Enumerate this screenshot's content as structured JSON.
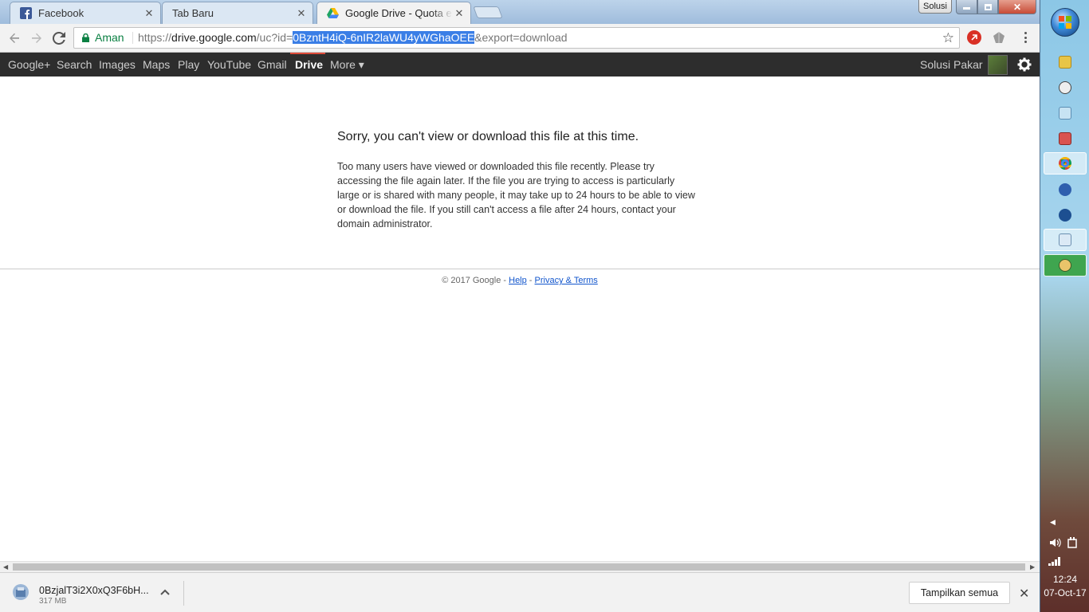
{
  "tabs": [
    {
      "title": "Facebook",
      "favicon": "facebook-icon",
      "active": false
    },
    {
      "title": "Tab Baru",
      "favicon": "",
      "active": false
    },
    {
      "title": "Google Drive - Quota exceeded",
      "favicon": "google-drive-icon",
      "active": true
    }
  ],
  "window": {
    "profile_label": "Solusi"
  },
  "toolbar": {
    "security_label": "Aman",
    "url_prefix": "https://",
    "url_host": "drive.google.com",
    "url_path": "/uc?id=",
    "url_selected": "0BzntH4iQ-6nIR2laWU4yWGhaOEE",
    "url_suffix": "&export=download"
  },
  "google_bar": {
    "items": [
      "Google+",
      "Search",
      "Images",
      "Maps",
      "Play",
      "YouTube",
      "Gmail",
      "Drive",
      "More ▾"
    ],
    "active": "Drive",
    "user_name": "Solusi Pakar"
  },
  "page": {
    "error_title": "Sorry, you can't view or download this file at this time.",
    "error_body": "Too many users have viewed or downloaded this file recently. Please try accessing the file again later. If the file you are trying to access is particularly large or is shared with many people, it may take up to 24 hours to be able to view or download the file. If you still can't access a file after 24 hours, contact your domain administrator.",
    "footer_copyright": "© 2017 Google - ",
    "footer_help": "Help",
    "footer_sep": " - ",
    "footer_privacy": "Privacy & Terms"
  },
  "download_bar": {
    "file_name": "0BzjalT3i2X0xQ3F6bH...",
    "file_size": "317 MB",
    "show_all_label": "Tampilkan semua"
  },
  "taskbar": {
    "clock_time": "12:24",
    "clock_date": "07-Oct-17"
  },
  "colors": {
    "gbar_bg": "#2d2d2d",
    "drive_accent": "#dd4b39",
    "secure_green": "#0b8043",
    "url_selection": "#3a7ee6",
    "link_blue": "#1155cc"
  }
}
